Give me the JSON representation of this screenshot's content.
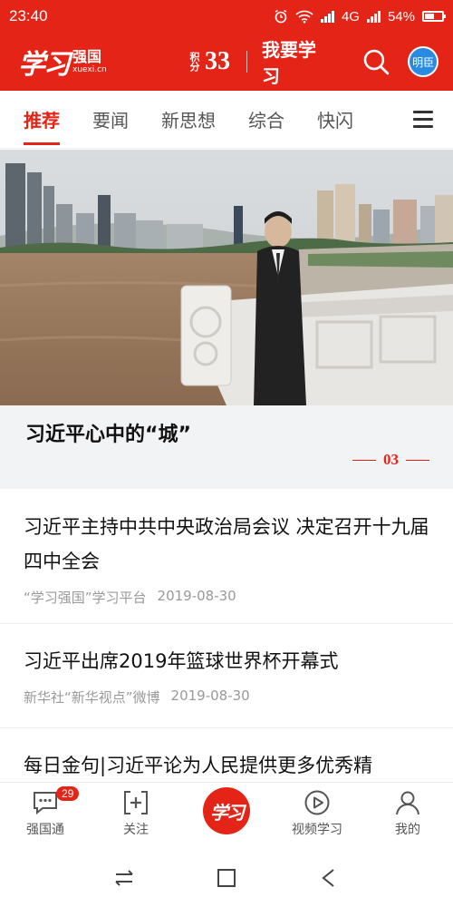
{
  "status": {
    "time": "23:40",
    "network": "4G",
    "battery_text": "54%",
    "battery_level": 0.54
  },
  "header": {
    "logo_mark": "学习",
    "logo_cn": "强国",
    "logo_en": "xuexi.cn",
    "points_label": "积分",
    "points_value": "33",
    "study_label": "我要学习",
    "avatar_text": "明臣"
  },
  "tabs": [
    {
      "label": "推荐",
      "active": true
    },
    {
      "label": "要闻"
    },
    {
      "label": "新思想"
    },
    {
      "label": "综合"
    },
    {
      "label": "快闪"
    }
  ],
  "hero": {
    "title": "习近平心中的“城”",
    "page": "03"
  },
  "news": [
    {
      "title": "习近平主持中共中央政治局会议 决定召开十九届四中全会",
      "source": "“学习强国”学习平台",
      "date": "2019-08-30"
    },
    {
      "title": "习近平出席2019年篮球世界杯开幕式",
      "source": "新华社“新华视点”微博",
      "date": "2019-08-30"
    },
    {
      "title": "每日金句|习近平论为人民提供更多优秀精"
    }
  ],
  "bottom_nav": {
    "items": [
      {
        "label": "强国通",
        "icon": "chat-icon",
        "badge": "29"
      },
      {
        "label": "关注",
        "icon": "follow-icon"
      },
      {
        "label": "",
        "icon": "xuexi-logo",
        "logo_text": "学习"
      },
      {
        "label": "视频学习",
        "icon": "play-icon"
      },
      {
        "label": "我的",
        "icon": "person-icon"
      }
    ]
  },
  "colors": {
    "brand": "#e42417",
    "avatar": "#2a8ae0"
  }
}
